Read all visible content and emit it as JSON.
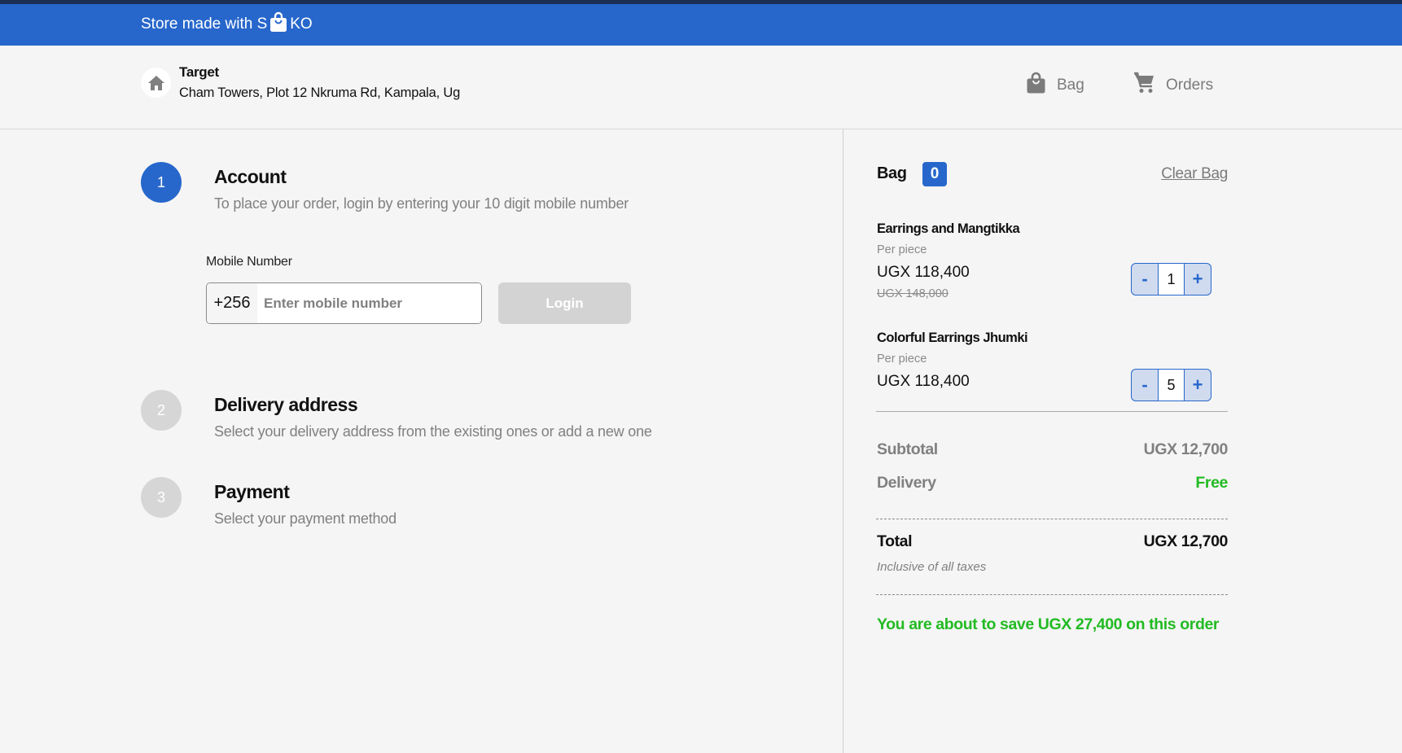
{
  "promo_bar": {
    "text_before": "Store made with S",
    "logo_icon": "shopping-bag-icon",
    "text_after": "KO"
  },
  "header": {
    "store_icon": "home-icon",
    "store_name": "Target",
    "store_address": "Cham Towers, Plot 12 Nkruma Rd, Kampala, Ug",
    "nav": [
      {
        "label": "Bag",
        "icon": "shopping-bag-icon"
      },
      {
        "label": "Orders",
        "icon": "cart-icon"
      }
    ]
  },
  "checkout": {
    "steps": [
      {
        "number": "1",
        "title": "Account",
        "description": "To place your order, login by entering your 10 digit mobile number",
        "state": "active"
      },
      {
        "number": "2",
        "title": "Delivery address",
        "description": "Select your delivery address from the existing ones or add a new one",
        "state": "inactive"
      },
      {
        "number": "3",
        "title": "Payment",
        "description": "Select your payment method",
        "state": "inactive"
      }
    ],
    "login_form": {
      "label": "Mobile Number",
      "country_code": "+256",
      "value": "",
      "placeholder": "Enter mobile number",
      "button_label": "Login",
      "button_disabled": true
    }
  },
  "bag": {
    "title": "Bag",
    "count_badge": "0",
    "clear_label": "Clear Bag",
    "items": [
      {
        "name": "Earrings and Mangtikka",
        "unit": "Per piece",
        "price": "UGX 118,400",
        "original_price": "UGX 148,000",
        "quantity": "1"
      },
      {
        "name": "Colorful Earrings Jhumki",
        "unit": "Per piece",
        "price": "UGX 118,400",
        "original_price": null,
        "quantity": "5"
      }
    ],
    "stepper": {
      "decrement": "-",
      "increment": "+"
    },
    "summary": {
      "subtotal_label": "Subtotal",
      "subtotal_value": "UGX 12,700",
      "delivery_label": "Delivery",
      "delivery_value": "Free",
      "total_label": "Total",
      "total_value": "UGX 12,700",
      "tax_note": "Inclusive of all taxes",
      "savings_message": "You are about to save UGX 27,400 on this order"
    }
  },
  "colors": {
    "brand_blue": "#2767cc",
    "top_strip": "#1b2f55",
    "success_green": "#22bb22",
    "muted_gray": "#808080",
    "disabled_button": "#d3d3d3"
  }
}
